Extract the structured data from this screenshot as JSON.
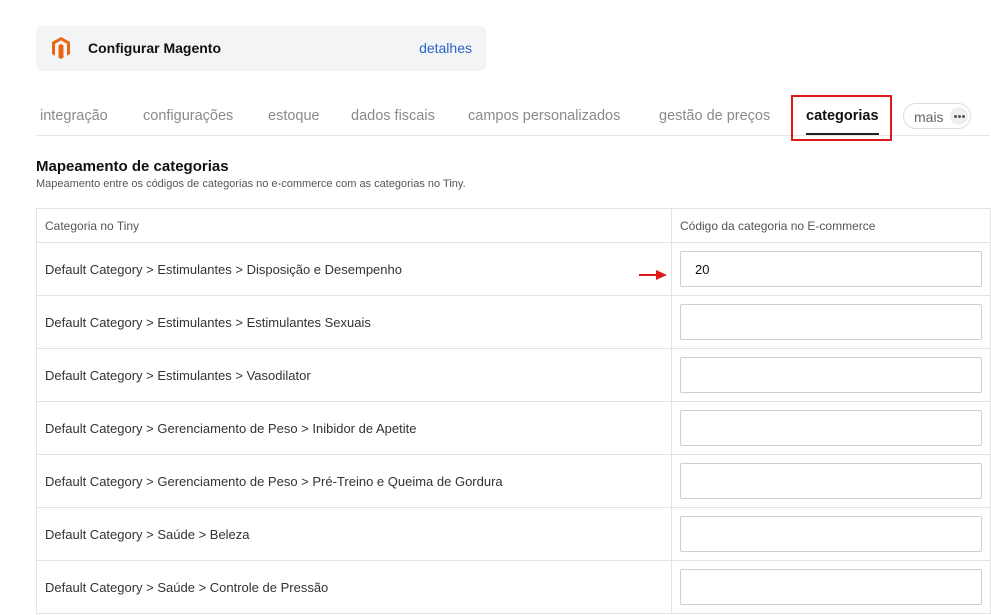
{
  "header": {
    "title": "Configurar Magento",
    "details_link": "detalhes",
    "logo_icon": "magento-logo-icon",
    "logo_color": "#ec6611"
  },
  "tabs": [
    {
      "label": "integração",
      "active": false
    },
    {
      "label": "configurações",
      "active": false
    },
    {
      "label": "estoque",
      "active": false
    },
    {
      "label": "dados fiscais",
      "active": false
    },
    {
      "label": "campos personalizados",
      "active": false
    },
    {
      "label": "gestão de preços",
      "active": false
    },
    {
      "label": "categorias",
      "active": true
    }
  ],
  "more_button": {
    "label": "mais",
    "icon": "more-dots-icon"
  },
  "section": {
    "title": "Mapeamento de categorias",
    "subtitle": "Mapeamento entre os códigos de categorias no e-commerce com as categorias no Tiny."
  },
  "table": {
    "headers": [
      "Categoria no Tiny",
      "Código da categoria no E-commerce"
    ],
    "rows": [
      {
        "category": "Default Category > Estimulantes > Disposição e Desempenho",
        "code": "20"
      },
      {
        "category": "Default Category > Estimulantes > Estimulantes Sexuais",
        "code": ""
      },
      {
        "category": "Default Category > Estimulantes > Vasodilator",
        "code": ""
      },
      {
        "category": "Default Category > Gerenciamento de Peso > Inibidor de Apetite",
        "code": ""
      },
      {
        "category": "Default Category > Gerenciamento de Peso > Pré-Treino e Queima de Gordura",
        "code": ""
      },
      {
        "category": "Default Category > Saúde > Beleza",
        "code": ""
      },
      {
        "category": "Default Category > Saúde > Controle de Pressão",
        "code": ""
      }
    ]
  },
  "colors": {
    "accent_link": "#2a64c5",
    "highlight": "#e01a1a"
  }
}
